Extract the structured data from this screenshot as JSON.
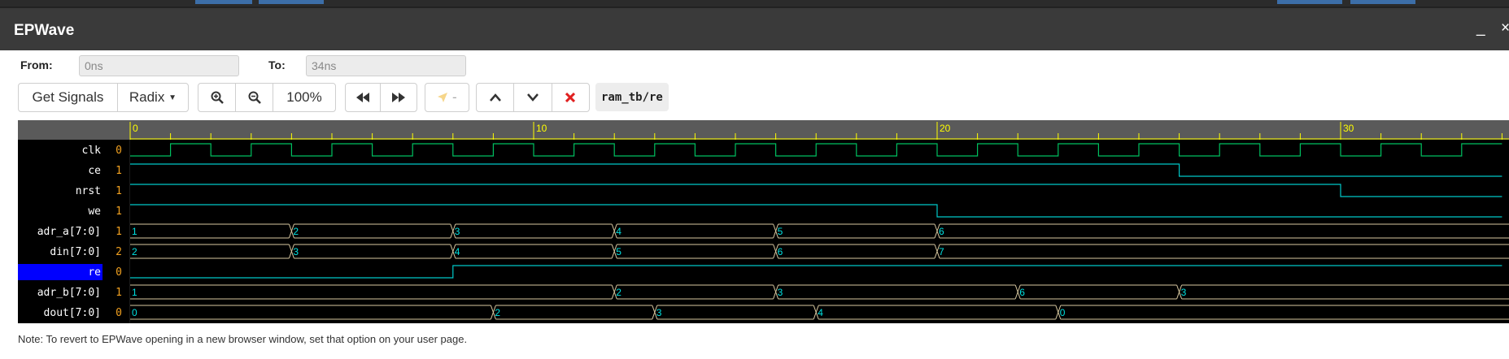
{
  "window": {
    "title": "EPWave"
  },
  "controls": {
    "from_label": "From:",
    "from_value": "0ns",
    "to_label": "To:",
    "to_value": "34ns",
    "get_signals_label": "Get Signals",
    "radix_label": "Radix",
    "zoom_level": "100%",
    "marker_label": "-",
    "signal_path": "ram_tb/re"
  },
  "icons": [
    "zoom-in-icon",
    "zoom-out-icon",
    "rewind-icon",
    "fast-forward-icon",
    "cursor-icon",
    "chevron-up-icon",
    "chevron-down-icon",
    "close-icon",
    "minimize-icon"
  ],
  "colors": {
    "waveform_bg": "#000000",
    "label_bg": "#000000",
    "ruler_bg": "#5a5a5a",
    "ruler_text": "#ffff00",
    "signal_name": "#ffffff",
    "signal_value": "#f0a020",
    "wire_high": "#00c060",
    "wire_alt": "#00c8c8",
    "bus_line": "#d8c8a0",
    "bus_text": "#00e0e0",
    "selected_bg": "#0000ff"
  },
  "waveform": {
    "time_range_ns": [
      0,
      34
    ],
    "ruler_labels": [
      0,
      10,
      20,
      30
    ],
    "clock_period_ns": 2,
    "selected_signal": "re",
    "signals": [
      {
        "name": "clk",
        "value": "0",
        "type": "clock"
      },
      {
        "name": "ce",
        "value": "1",
        "type": "wire",
        "transitions": [
          [
            0,
            1
          ],
          [
            26,
            0
          ]
        ]
      },
      {
        "name": "nrst",
        "value": "1",
        "type": "wire",
        "transitions": [
          [
            0,
            1
          ],
          [
            30,
            0
          ]
        ]
      },
      {
        "name": "we",
        "value": "1",
        "type": "wire",
        "transitions": [
          [
            0,
            1
          ],
          [
            20,
            0
          ]
        ]
      },
      {
        "name": "adr_a[7:0]",
        "value": "1",
        "type": "bus",
        "segments": [
          [
            0,
            "1"
          ],
          [
            4,
            "2"
          ],
          [
            8,
            "3"
          ],
          [
            12,
            "4"
          ],
          [
            16,
            "5"
          ],
          [
            20,
            "6"
          ]
        ]
      },
      {
        "name": "din[7:0]",
        "value": "2",
        "type": "bus",
        "segments": [
          [
            0,
            "2"
          ],
          [
            4,
            "3"
          ],
          [
            8,
            "4"
          ],
          [
            12,
            "5"
          ],
          [
            16,
            "6"
          ],
          [
            20,
            "7"
          ]
        ]
      },
      {
        "name": "re",
        "value": "0",
        "type": "wire",
        "transitions": [
          [
            0,
            0
          ],
          [
            8,
            1
          ]
        ]
      },
      {
        "name": "adr_b[7:0]",
        "value": "1",
        "type": "bus",
        "segments": [
          [
            0,
            "1"
          ],
          [
            12,
            "2"
          ],
          [
            16,
            "3"
          ],
          [
            22,
            "6"
          ],
          [
            26,
            "3"
          ]
        ]
      },
      {
        "name": "dout[7:0]",
        "value": "0",
        "type": "bus",
        "segments": [
          [
            0,
            "0"
          ],
          [
            9,
            "2"
          ],
          [
            13,
            "3"
          ],
          [
            17,
            "4"
          ],
          [
            23,
            "0"
          ]
        ]
      }
    ]
  },
  "note": "Note: To revert to EPWave opening in a new browser window, set that option on your user page."
}
